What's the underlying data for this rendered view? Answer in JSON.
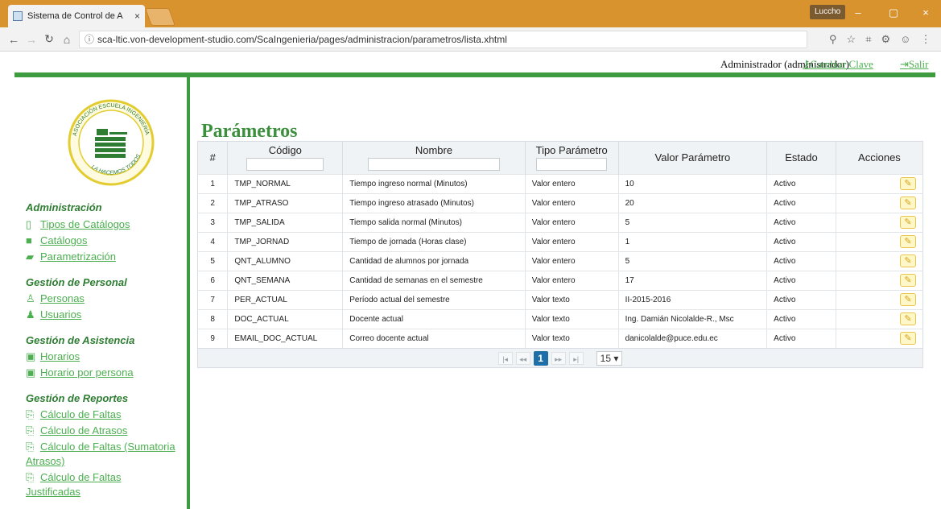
{
  "browser": {
    "tab_title": "Sistema de Control de A",
    "tab_close": "×",
    "user_pill": "Luccho",
    "url_info": "ⓘ",
    "url": "sca-ltic.von-development-studio.com/ScaIngenieria/pages/administracion/parametros/lista.xhtml",
    "win_min": "–",
    "win_max": "▢",
    "win_close": "×"
  },
  "header": {
    "user": "Administrador (administrador)",
    "change_password": "Cambiar Clave",
    "logout": "Salir"
  },
  "logo": {
    "top_text": "ASOCIACIÓN ESCUELA INGENIERÍA",
    "bottom_text": "LA HACEMOS TODOS"
  },
  "sidebar": {
    "sections": [
      {
        "title": "Administración",
        "items": [
          "Tipos de Catálogos",
          "Catálogos",
          "Parametrización"
        ]
      },
      {
        "title": "Gestión de Personal",
        "items": [
          "Personas",
          "Usuarios"
        ]
      },
      {
        "title": "Gestión de Asistencia",
        "items": [
          "Horarios",
          "Horario por persona"
        ]
      },
      {
        "title": "Gestión de Reportes",
        "items": [
          "Cálculo de Faltas",
          "Cálculo de Atrasos",
          "Cálculo de Faltas (Sumatoria",
          "Atrasos)",
          "Cálculo de Faltas",
          "Justificadas"
        ]
      }
    ]
  },
  "page": {
    "title": "Parámetros"
  },
  "table": {
    "headers": [
      "#",
      "Código",
      "Nombre",
      "Tipo Parámetro",
      "Valor Parámetro",
      "Estado",
      "Acciones"
    ],
    "rows": [
      [
        "1",
        "TMP_NORMAL",
        "Tiempo ingreso normal (Minutos)",
        "Valor entero",
        "10",
        "Activo"
      ],
      [
        "2",
        "TMP_ATRASO",
        "Tiempo ingreso atrasado (Minutos)",
        "Valor entero",
        "20",
        "Activo"
      ],
      [
        "3",
        "TMP_SALIDA",
        "Tiempo salida normal (Minutos)",
        "Valor entero",
        "5",
        "Activo"
      ],
      [
        "4",
        "TMP_JORNAD",
        "Tiempo de jornada (Horas clase)",
        "Valor entero",
        "1",
        "Activo"
      ],
      [
        "5",
        "QNT_ALUMNO",
        "Cantidad de alumnos por jornada",
        "Valor entero",
        "5",
        "Activo"
      ],
      [
        "6",
        "QNT_SEMANA",
        "Cantidad de semanas en el semestre",
        "Valor entero",
        "17",
        "Activo"
      ],
      [
        "7",
        "PER_ACTUAL",
        "Período actual del semestre",
        "Valor texto",
        "II-2015-2016",
        "Activo"
      ],
      [
        "8",
        "DOC_ACTUAL",
        "Docente actual",
        "Valor texto",
        "Ing. Damián Nicolalde-R., Msc",
        "Activo"
      ],
      [
        "9",
        "EMAIL_DOC_ACTUAL",
        "Correo docente actual",
        "Valor texto",
        "danicolalde@puce.edu.ec",
        "Activo"
      ]
    ]
  },
  "paginator": {
    "first": "|◂",
    "prev": "◂◂",
    "current_page": "1",
    "next": "▸▸",
    "last": "▸|",
    "page_size": "15 ▾"
  },
  "colors": {
    "brand_green": "#3f9b3f",
    "link_green": "#4caf50",
    "chrome_orange": "#d8922e"
  }
}
